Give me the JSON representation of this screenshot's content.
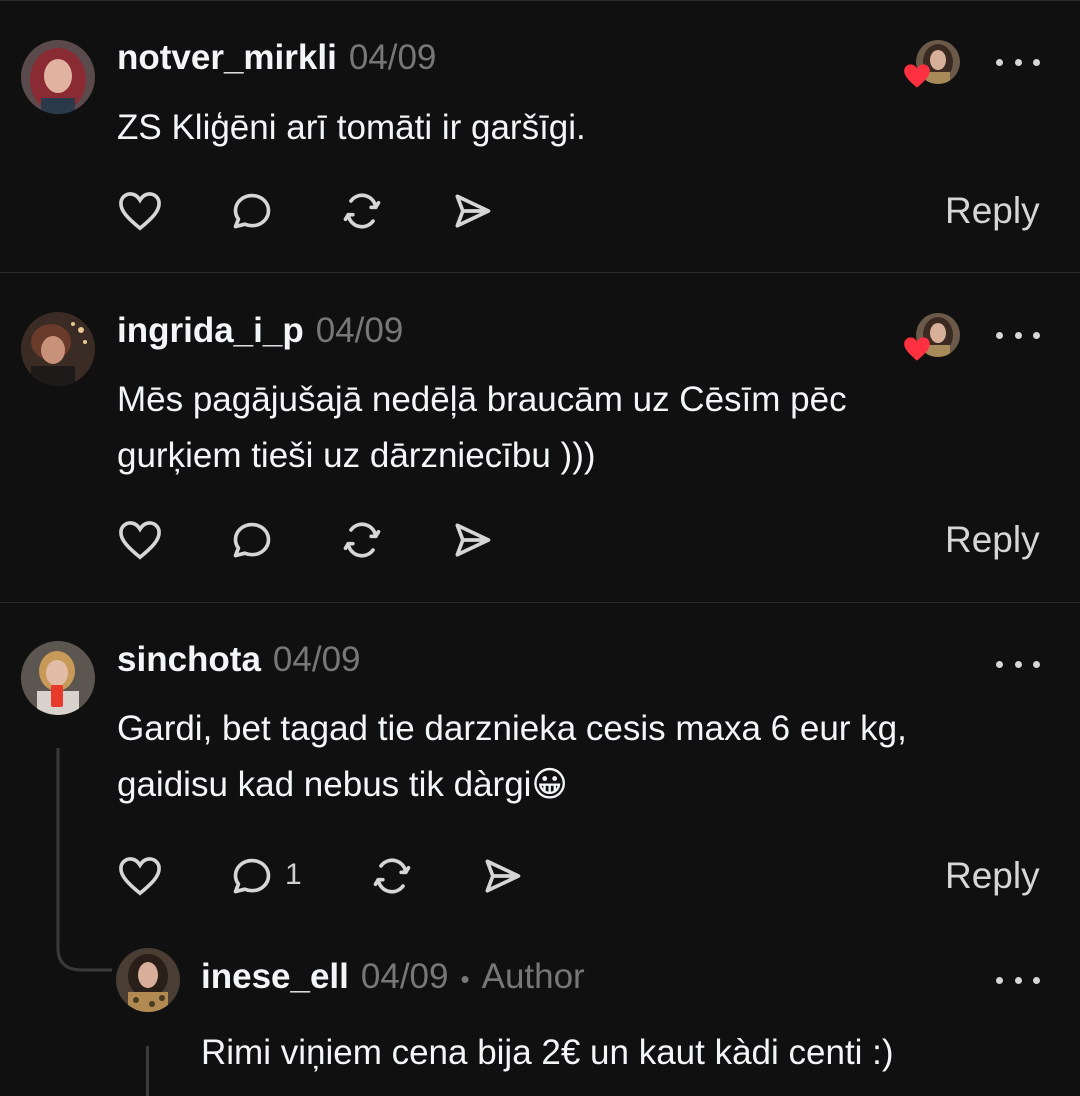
{
  "comments": [
    {
      "username": "notver_mirkli",
      "date": "04/09",
      "text": "ZS Kliģēni arī tomāti ir garšīgi.",
      "reply_label": "Reply"
    },
    {
      "username": "ingrida_i_p",
      "date": "04/09",
      "text_line1": "Mēs pagājušajā nedēļā braucām uz Cēsīm pēc",
      "text_line2": "gurķiem tieši uz dārzniecību )))",
      "reply_label": "Reply"
    },
    {
      "username": "sinchota",
      "date": "04/09",
      "text_line1": "Gardi, bet tagad tie darznieka cesis maxa 6 eur kg,",
      "text_line2": "gaidisu kad nebus tik dàrgi😀",
      "reply_count": "1",
      "reply_label": "Reply"
    }
  ],
  "nested_reply": {
    "username": "inese_ell",
    "date": "04/09",
    "separator": "•",
    "badge": "Author",
    "text": "Rimi viņiem cena bija 2€ un kaut kàdi centi :)"
  },
  "icons": {
    "like": "heart-outline-icon",
    "comment": "comment-bubble-icon",
    "repost": "repost-icon",
    "share": "send-icon",
    "more": "more-dots-icon",
    "liked_by_author": "heart-filled-icon"
  },
  "colors": {
    "background": "#101010",
    "text": "#f3f5f7",
    "secondary": "#777777",
    "heart": "#ff3040",
    "divider": "#2c2c2c"
  }
}
